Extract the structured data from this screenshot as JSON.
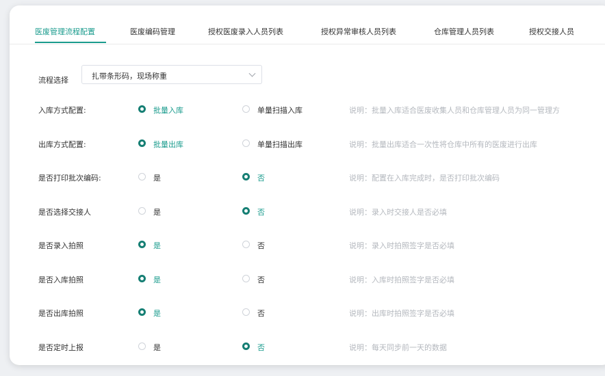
{
  "tabs": [
    {
      "label": "医废管理流程配置"
    },
    {
      "label": "医废编码管理"
    },
    {
      "label": "授权医废录入人员列表"
    },
    {
      "label": "授权异常审核人员列表"
    },
    {
      "label": "仓库管理人员列表"
    },
    {
      "label": "授权交接人员"
    }
  ],
  "flow": {
    "label": "流程选择",
    "selected": "扎带条形码，现场称重"
  },
  "settings": [
    {
      "label": "入库方式配置:",
      "option1": "批量入库",
      "option2": "单量扫描入库",
      "selected": 1,
      "desc": "说明：批量入库适合医废收集人员和仓库管理人员为同一管理方"
    },
    {
      "label": "出库方式配置:",
      "option1": "批量出库",
      "option2": "单量扫描出库",
      "selected": 1,
      "desc": "说明：批量出库适合一次性将仓库中所有的医废进行出库"
    },
    {
      "label": "是否打印批次编码:",
      "option1": "是",
      "option2": "否",
      "selected": 2,
      "desc": "说明：配置在入库完成时，是否打印批次编码"
    },
    {
      "label": "是否选择交接人",
      "option1": "是",
      "option2": "否",
      "selected": 2,
      "desc": "说明：录入时交接人是否必填"
    },
    {
      "label": "是否录入拍照",
      "option1": "是",
      "option2": "否",
      "selected": 1,
      "desc": "说明：录入时拍照签字是否必填"
    },
    {
      "label": "是否入库拍照",
      "option1": "是",
      "option2": "否",
      "selected": 1,
      "desc": "说明：入库时拍照签字是否必填"
    },
    {
      "label": "是否出库拍照",
      "option1": "是",
      "option2": "否",
      "selected": 1,
      "desc": "说明：出库时拍照签字是否必填"
    },
    {
      "label": "是否定时上报",
      "option1": "是",
      "option2": "否",
      "selected": 2,
      "desc": "说明：每天同步前一天的数据"
    }
  ],
  "colors": {
    "accent": "#1a9b8d",
    "radio": "#167f74",
    "muted": "#b4b8be"
  }
}
